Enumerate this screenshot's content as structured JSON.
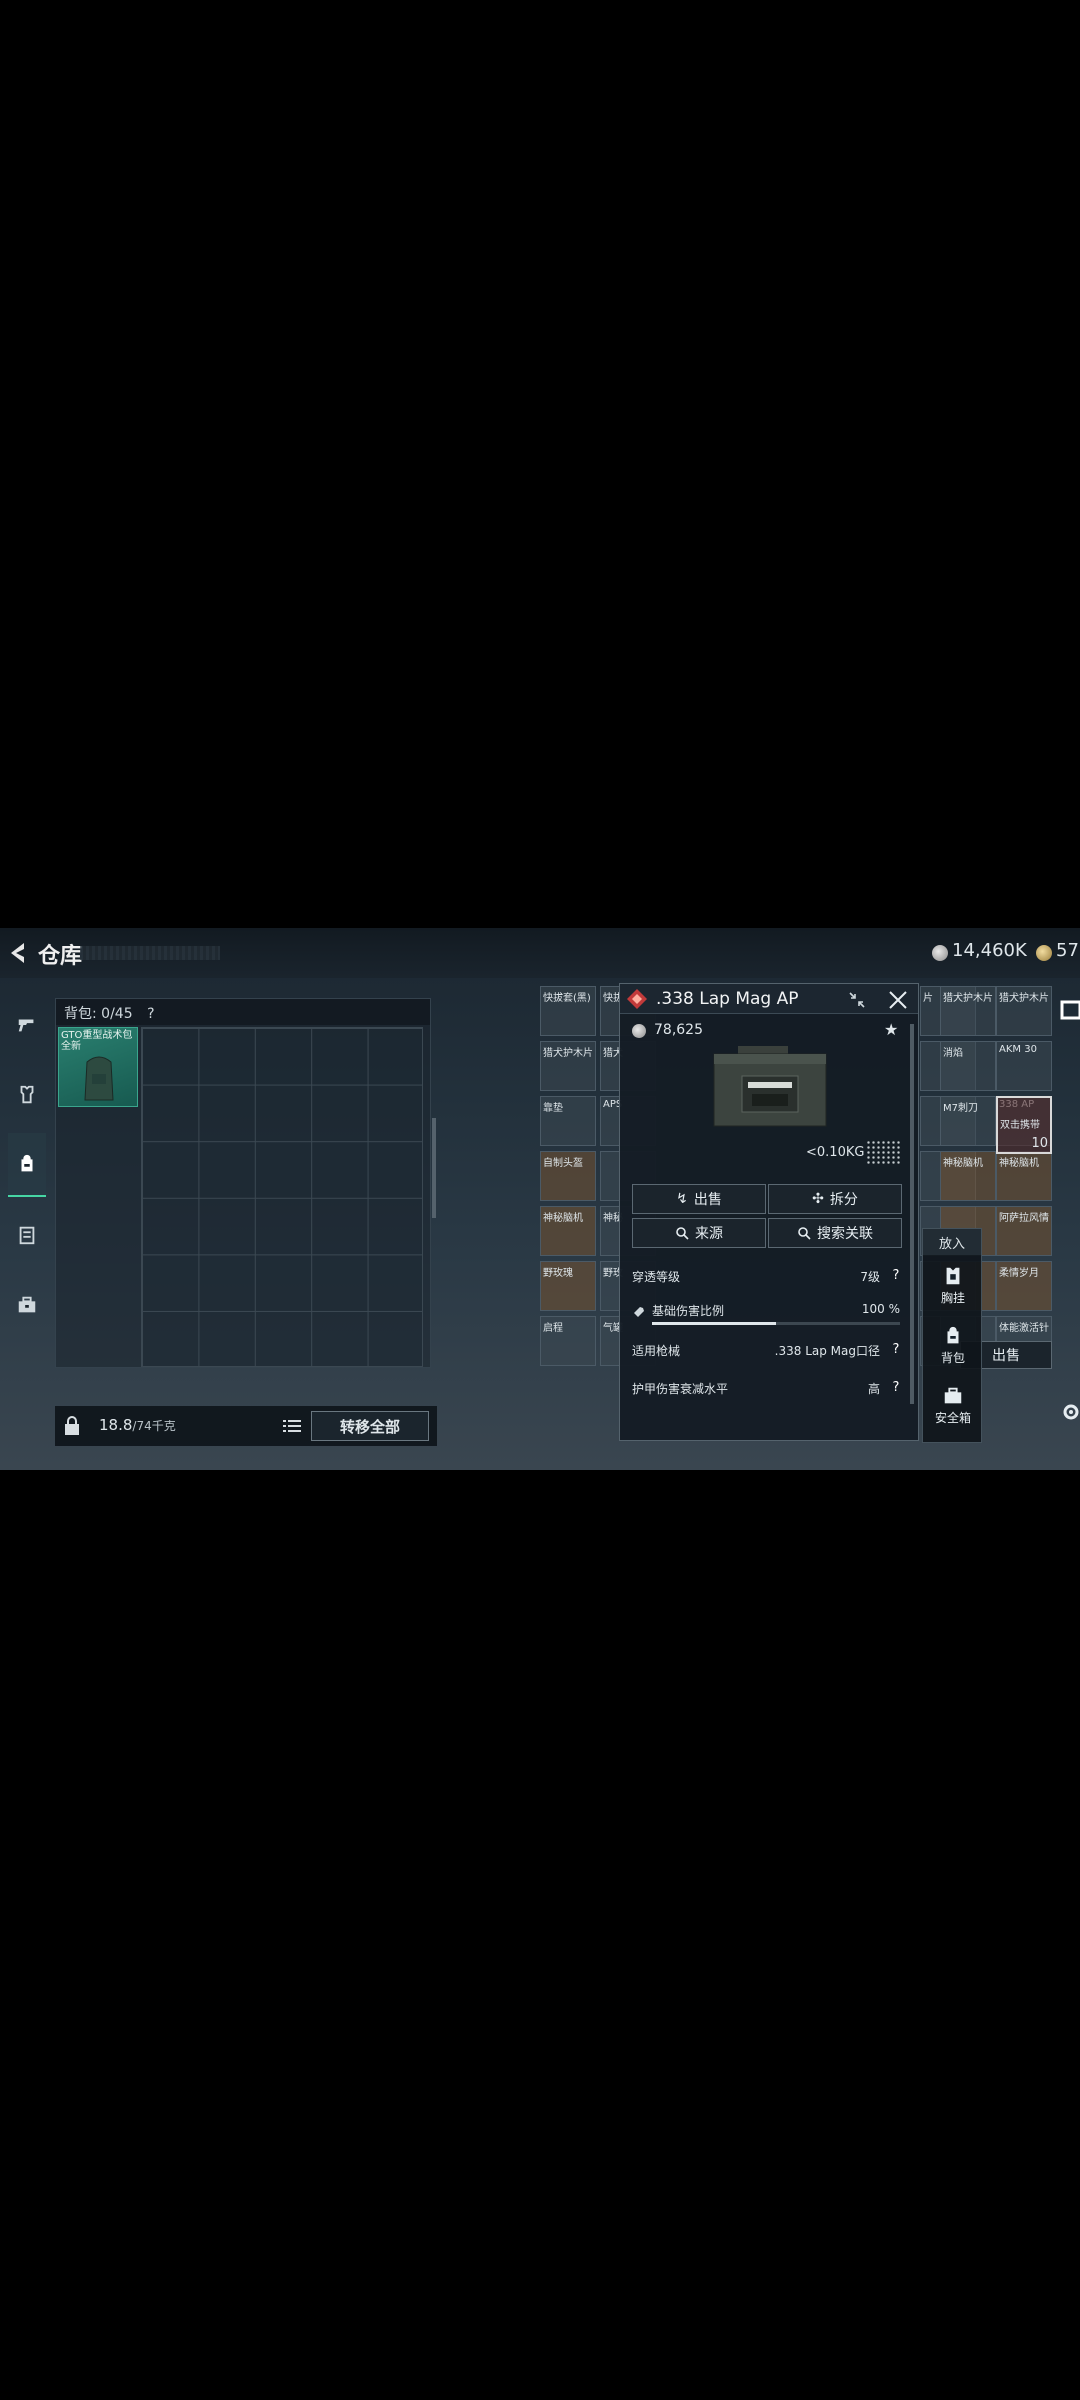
{
  "topbar": {
    "title": "仓库",
    "silver_currency": "14,460K",
    "gold_currency": "57"
  },
  "sidebar": {
    "items": [
      {
        "icon": "pistol-icon"
      },
      {
        "icon": "armor-icon"
      },
      {
        "icon": "backpack-icon",
        "active": true
      },
      {
        "icon": "clipboard-icon"
      },
      {
        "icon": "toolbox-icon"
      }
    ]
  },
  "backpack": {
    "header": "背包: 0/45",
    "help": "?",
    "item_label": "GTO重型战术包 全新",
    "weight_value": "18.8",
    "weight_max": "/74千克",
    "transfer_all": "转移全部"
  },
  "inventory": {
    "cells": [
      "快拔套(黑)",
      "快拔",
      "片",
      "猎犬护木片",
      "猎犬护木片",
      "猎犬护木片",
      "猎犬",
      "",
      "消焰",
      "AKM 30",
      "靠垫",
      "APS",
      "",
      "M7刺刀",
      "338 AP",
      "自制头盔",
      "",
      "",
      "神秘脑机",
      "神秘脑机",
      "神秘脑机",
      "神秘",
      "",
      "",
      "阿萨拉风情",
      "野玫瑰",
      "野玫",
      "",
      "",
      "柔情岁月",
      "启程",
      "气罐",
      "",
      "",
      "体能激活针"
    ],
    "double_click_hint": "双击携带",
    "stack_count": "10",
    "sell_label": "出售"
  },
  "detail": {
    "item_name": ".338 Lap Mag AP",
    "price": "78,625",
    "weight": "<0.10KG",
    "buttons": {
      "sell": "出售",
      "dismantle": "拆分",
      "source": "来源",
      "search_related": "搜索关联"
    },
    "stats": {
      "penetration_label": "穿透等级",
      "penetration_value": "7级",
      "base_damage_label": "基础伤害比例",
      "base_damage_value": "100 %",
      "base_damage_fraction": 0.5,
      "weapon_label": "适用枪械",
      "weapon_value": ".338 Lap Mag口径",
      "armor_damage_label": "护甲伤害衰减水平",
      "armor_damage_value": "高"
    }
  },
  "put_in": {
    "title": "放入",
    "chest_rig": "胸挂",
    "backpack": "背包",
    "safe_box": "安全箱"
  }
}
